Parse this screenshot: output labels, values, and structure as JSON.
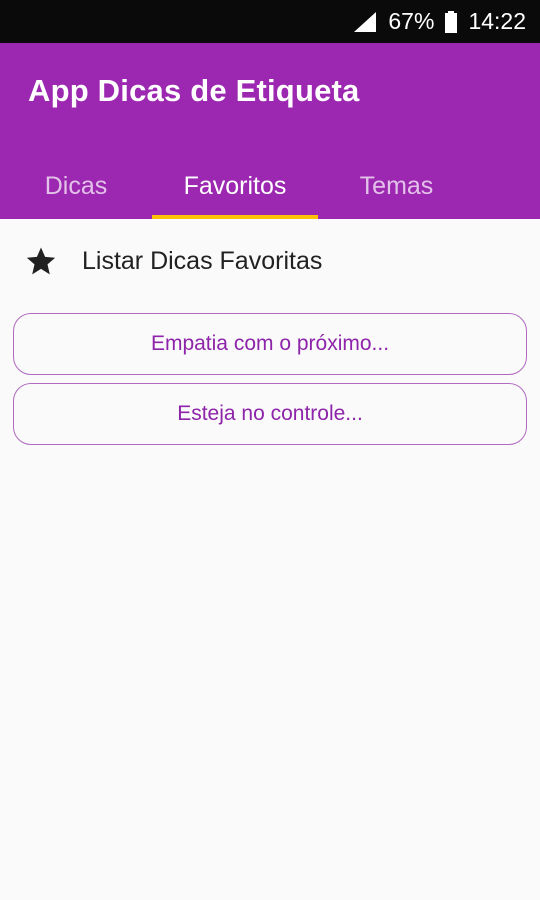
{
  "status_bar": {
    "battery_percent": "67%",
    "time": "14:22",
    "icons": [
      "signal-icon",
      "battery-icon"
    ]
  },
  "app_bar": {
    "title": "App Dicas de Etiqueta",
    "color": "#9c27b0"
  },
  "tabs": [
    {
      "label": "Dicas",
      "selected": false
    },
    {
      "label": "Favoritos",
      "selected": true
    },
    {
      "label": "Temas",
      "selected": false
    }
  ],
  "tab_indicator_color": "#ffc107",
  "favorites_header": {
    "icon": "star-icon",
    "label": "Listar Dicas Favoritas"
  },
  "favorite_tips": [
    {
      "label": "Empatia com o próximo..."
    },
    {
      "label": "Esteja no controle..."
    }
  ],
  "accent_color": "#8e24aa"
}
